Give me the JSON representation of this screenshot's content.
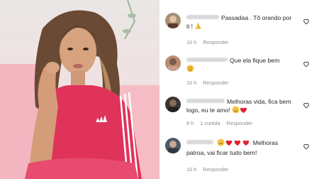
{
  "comments": [
    {
      "text": "Passadaa . Tô orando por ti !",
      "emoji_after": "praying-hands",
      "time": "10 h",
      "reply_label": "Responder"
    },
    {
      "text": "Que ela fique bem",
      "emoji_after": "sad-face",
      "time": "10 h",
      "reply_label": "Responder"
    },
    {
      "text": "Melhoras vida, fica bem logo, eu te amo!",
      "emoji_after": "smile-hearts",
      "time": "9 h",
      "likes": "1 curtida",
      "reply_label": "Responder"
    },
    {
      "text_before_emojis": "",
      "text": "Melhoras patroa, vai ficar tudo bem!",
      "emoji_before": "face-and-three-hearts",
      "time": "10 h",
      "reply_label": "Responder"
    }
  ],
  "colors": {
    "shirt": "#e0335a",
    "meta": "#8e8e8e",
    "heart_outline": "#262626"
  },
  "icons": [
    "heart-outline-icon",
    "avatar",
    "praying-hands-emoji",
    "sad-face-emoji",
    "red-heart-emoji"
  ]
}
